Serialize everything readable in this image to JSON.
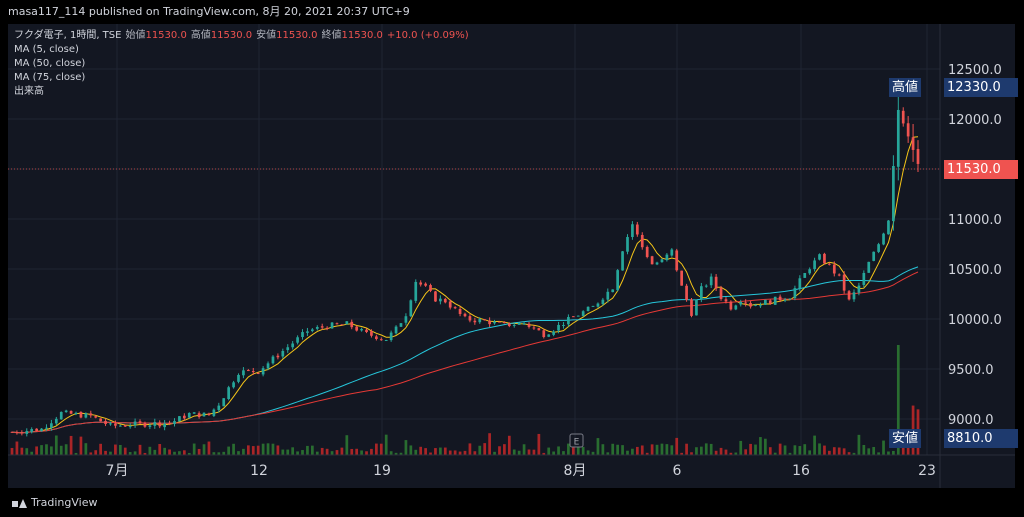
{
  "header": {
    "publish_text": "masa117_114 published on TradingView.com, 8月 20, 2021 20:37 UTC+9"
  },
  "legend": {
    "symbol": "フクダ電子, 1時間, TSE",
    "open_label": "始値",
    "open": "11530.0",
    "high_label": "高値",
    "high": "11530.0",
    "low_label": "安値",
    "low": "11530.0",
    "close_label": "終値",
    "close": "11530.0",
    "change": "+10.0 (+0.09%)",
    "ma5": "MA (5, close)",
    "ma50": "MA (50, close)",
    "ma75": "MA (75, close)",
    "volume": "出来高"
  },
  "badges": {
    "high_label": "高値",
    "high_value": "12330.0",
    "last_value": "11530.0",
    "low_label": "安値",
    "low_value": "8810.0",
    "event_marker": "E"
  },
  "footer": {
    "brand": "TradingView"
  },
  "colors": {
    "up": "#26a69a",
    "down": "#ef5350",
    "ma5": "#f5c518",
    "ma50": "#26c6da",
    "ma75": "#e53935",
    "vol_up": "#2e7d32",
    "vol_down": "#c62828",
    "badge_blue": "#1e3a6e"
  },
  "chart_data": {
    "type": "candlestick",
    "y_ticks": [
      "12500.0",
      "12000.0",
      "11500.0",
      "11000.0",
      "10500.0",
      "10000.0",
      "9500.0",
      "9000.0"
    ],
    "x_ticks": [
      "7月",
      "12",
      "19",
      "8月",
      "6",
      "16",
      "23"
    ],
    "ylim": [
      8800,
      12700
    ],
    "highest": 12330.0,
    "lowest": 8810.0,
    "last_price": 11530.0,
    "keypoints": [
      [
        0,
        8870
      ],
      [
        3,
        8900
      ],
      [
        5,
        9060
      ],
      [
        8,
        9030
      ],
      [
        10,
        8930
      ],
      [
        13,
        8950
      ],
      [
        16,
        8960
      ],
      [
        18,
        9050
      ],
      [
        20,
        9040
      ],
      [
        21,
        9150
      ],
      [
        23,
        9470
      ],
      [
        25,
        9480
      ],
      [
        28,
        9720
      ],
      [
        30,
        9880
      ],
      [
        32,
        9930
      ],
      [
        34,
        9950
      ],
      [
        36,
        9850
      ],
      [
        38,
        9800
      ],
      [
        39,
        9900
      ],
      [
        40,
        10050
      ],
      [
        41,
        10380
      ],
      [
        42,
        10310
      ],
      [
        43,
        10200
      ],
      [
        44,
        10180
      ],
      [
        46,
        10000
      ],
      [
        48,
        9980
      ],
      [
        50,
        9940
      ],
      [
        52,
        9960
      ],
      [
        54,
        9850
      ],
      [
        55,
        9900
      ],
      [
        57,
        10020
      ],
      [
        59,
        10120
      ],
      [
        61,
        10320
      ],
      [
        62,
        10700
      ],
      [
        63,
        10950
      ],
      [
        64,
        10720
      ],
      [
        65,
        10550
      ],
      [
        66,
        10580
      ],
      [
        67,
        10680
      ],
      [
        68,
        10320
      ],
      [
        69,
        10060
      ],
      [
        70,
        10300
      ],
      [
        71,
        10400
      ],
      [
        72,
        10220
      ],
      [
        73,
        10120
      ],
      [
        74,
        10200
      ],
      [
        75,
        10140
      ],
      [
        77,
        10180
      ],
      [
        79,
        10230
      ],
      [
        80,
        10380
      ],
      [
        81,
        10520
      ],
      [
        82,
        10620
      ],
      [
        83,
        10530
      ],
      [
        84,
        10410
      ],
      [
        85,
        10180
      ],
      [
        86,
        10330
      ],
      [
        87,
        10560
      ],
      [
        88,
        10750
      ],
      [
        89,
        11000
      ],
      [
        90,
        12100
      ],
      [
        91,
        11850
      ],
      [
        92,
        11530
      ]
    ],
    "series": [
      {
        "name": "MA (5, close)",
        "kind": "ma5"
      },
      {
        "name": "MA (50, close)",
        "kind": "ma50"
      },
      {
        "name": "MA (75, close)",
        "kind": "ma75"
      },
      {
        "name": "出来高",
        "kind": "volume"
      }
    ]
  }
}
